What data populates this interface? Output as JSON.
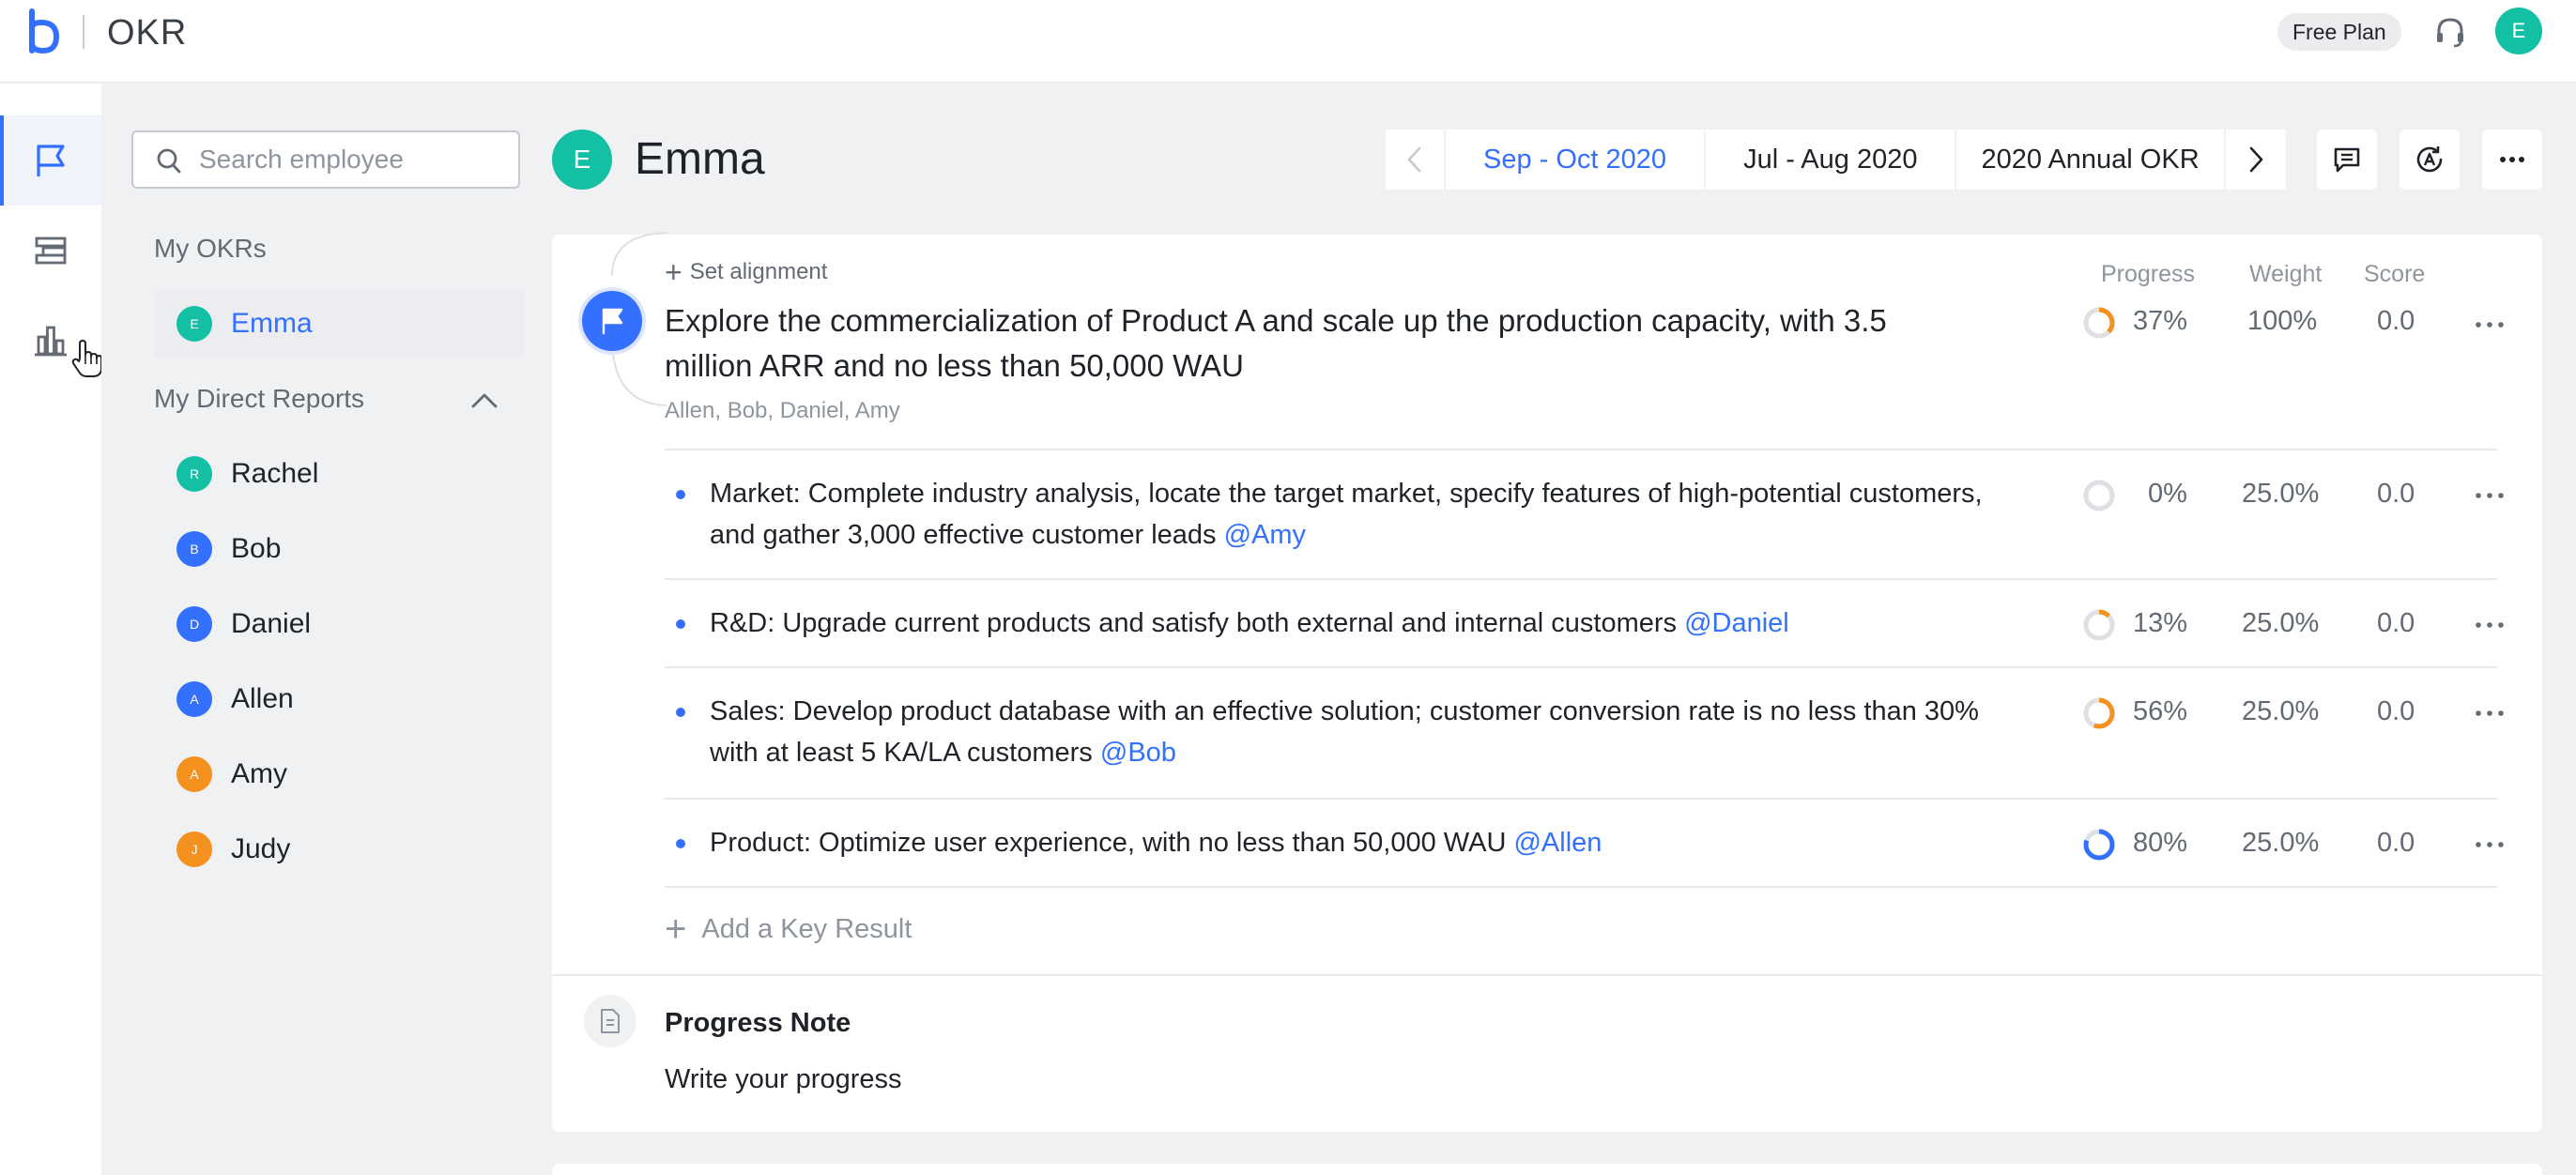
{
  "header": {
    "app_title": "OKR",
    "plan_badge": "Free Plan",
    "user_initial": "E"
  },
  "colors": {
    "accent": "#3370ff",
    "teal_avatar": "#14c0a3",
    "blue_avatar": "#3370ff",
    "orange_avatar": "#f5911f",
    "ring_orange": "#f5911f",
    "ring_blue": "#3370ff",
    "ring_track": "#dee0e3"
  },
  "rail": {
    "items": [
      {
        "icon": "flag-icon",
        "active": true
      },
      {
        "icon": "list-icon",
        "active": false
      },
      {
        "icon": "bar-chart-icon",
        "active": false
      }
    ]
  },
  "search": {
    "placeholder": "Search employee",
    "value": ""
  },
  "sidebar": {
    "my_okrs_title": "My OKRs",
    "my_okrs": [
      {
        "initial": "E",
        "name": "Emma",
        "color": "#14c0a3",
        "selected": true
      }
    ],
    "direct_reports_title": "My Direct Reports",
    "direct_reports": [
      {
        "initial": "R",
        "name": "Rachel",
        "color": "#14c0a3"
      },
      {
        "initial": "B",
        "name": "Bob",
        "color": "#3370ff"
      },
      {
        "initial": "D",
        "name": "Daniel",
        "color": "#3370ff"
      },
      {
        "initial": "A",
        "name": "Allen",
        "color": "#3370ff"
      },
      {
        "initial": "A",
        "name": "Amy",
        "color": "#f5911f"
      },
      {
        "initial": "J",
        "name": "Judy",
        "color": "#f5911f"
      }
    ]
  },
  "main": {
    "avatar_initial": "E",
    "name": "Emma",
    "periods": [
      {
        "label": "Sep - Oct 2020",
        "active": true
      },
      {
        "label": "Jul - Aug 2020",
        "active": false
      },
      {
        "label": "2020 Annual OKR",
        "active": false
      }
    ]
  },
  "okr": {
    "set_alignment": "Set alignment",
    "columns": {
      "progress": "Progress",
      "weight": "Weight",
      "score": "Score"
    },
    "objective": {
      "text": "Explore the commercialization of Product A and scale up the production capacity, with 3.5 million ARR and no less than 50,000 WAU",
      "members": "Allen, Bob, Daniel, Amy",
      "progress_label": "37%",
      "progress": 0.37,
      "weight": "100%",
      "score": "0.0"
    },
    "key_results": [
      {
        "text": "Market: Complete industry analysis, locate the target market, specify features of high-potential customers, and gather 3,000 effective customer leads",
        "mention": "@Amy",
        "progress_label": "0%",
        "progress": 0.0,
        "weight": "25.0%",
        "score": "0.0",
        "ring_color": "#f5911f"
      },
      {
        "text": "R&D: Upgrade current products and satisfy both external and internal customers",
        "mention": "@Daniel",
        "progress_label": "13%",
        "progress": 0.13,
        "weight": "25.0%",
        "score": "0.0",
        "ring_color": "#f5911f"
      },
      {
        "text": "Sales: Develop product database with an effective solution; customer conversion rate is no less than 30% with at least 5 KA/LA customers",
        "mention": "@Bob",
        "progress_label": "56%",
        "progress": 0.56,
        "weight": "25.0%",
        "score": "0.0",
        "ring_color": "#f5911f"
      },
      {
        "text": "Product: Optimize user experience, with no less than 50,000 WAU",
        "mention": "@Allen",
        "progress_label": "80%",
        "progress": 0.8,
        "weight": "25.0%",
        "score": "0.0",
        "ring_color": "#3370ff"
      }
    ],
    "add_key_result": "Add a Key Result"
  },
  "progress_note": {
    "title": "Progress Note",
    "placeholder": "Write your progress"
  }
}
